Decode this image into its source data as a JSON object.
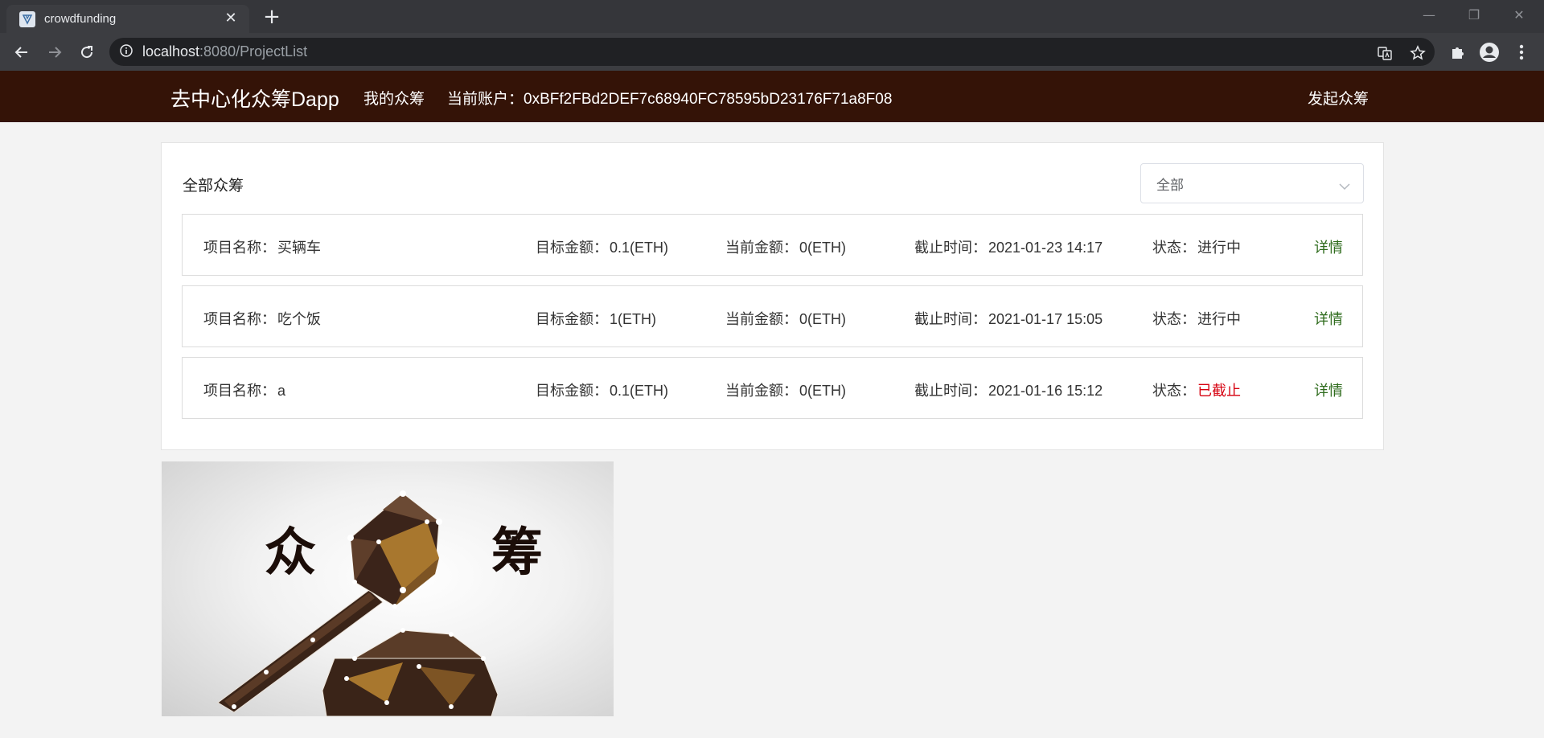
{
  "browser": {
    "tab_title": "crowdfunding",
    "url_host": "localhost",
    "url_rest": ":8080/ProjectList"
  },
  "appbar": {
    "brand": "去中心化众筹Dapp",
    "my_funding": "我的众筹",
    "account_label": "当前账户：",
    "account_value": "0xBFf2FBd2DEF7c68940FC78595bD23176F71a8F08",
    "create_funding": "发起众筹"
  },
  "panel": {
    "title": "全部众筹",
    "filter_value": "全部"
  },
  "labels": {
    "name": "项目名称：",
    "target": "目标金额：",
    "current": "当前金额：",
    "deadline": "截止时间：",
    "status": "状态：",
    "detail": "详情"
  },
  "projects": [
    {
      "name": "买辆车",
      "target": "0.1(ETH)",
      "current": "0(ETH)",
      "deadline": "2021-01-23 14:17",
      "status": "进行中",
      "status_color": "#333333"
    },
    {
      "name": "吃个饭",
      "target": "1(ETH)",
      "current": "0(ETH)",
      "deadline": "2021-01-17 15:05",
      "status": "进行中",
      "status_color": "#333333"
    },
    {
      "name": "a",
      "target": "0.1(ETH)",
      "current": "0(ETH)",
      "deadline": "2021-01-16 15:12",
      "status": "已截止",
      "status_color": "#d6000f"
    }
  ],
  "banner": {
    "left_char": "众",
    "right_char": "筹"
  },
  "colors": {
    "appbar_bg": "#341307",
    "detail_link": "#2e6b1c",
    "ended_status": "#d6000f"
  }
}
